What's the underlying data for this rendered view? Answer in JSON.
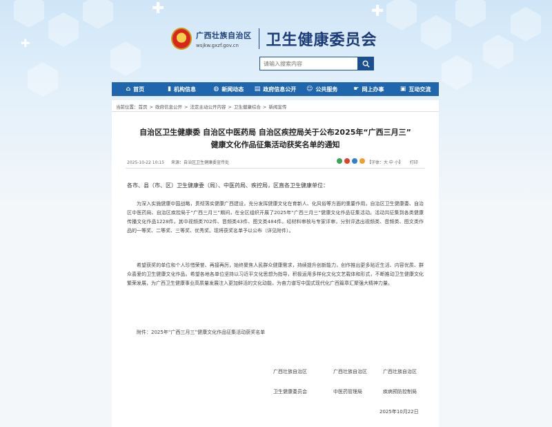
{
  "header": {
    "org_name": "广西壮族自治区",
    "url": "wsjkw.gxzf.gov.cn",
    "site_title": "卫生健康委员会"
  },
  "search": {
    "placeholder": "请输入搜索内容"
  },
  "nav": {
    "items": [
      {
        "label": "首页",
        "icon": "home-icon"
      },
      {
        "label": "机构信息",
        "icon": "bar-chart-icon"
      },
      {
        "label": "新闻动态",
        "icon": "globe-icon"
      },
      {
        "label": "政府信息公开",
        "icon": "document-icon"
      },
      {
        "label": "公共服务",
        "icon": "people-icon"
      },
      {
        "label": "网上办事",
        "icon": "hand-icon"
      },
      {
        "label": "互动交流",
        "icon": "chat-icon"
      }
    ]
  },
  "breadcrumb": {
    "prefix": "当前位置：",
    "items": [
      "首页",
      "政府信息公开",
      "法定主动公开内容",
      "卫生健康综合",
      "新闻宣传"
    ]
  },
  "article": {
    "title_line1": "自治区卫生健康委 自治区中医药局 自治区疾控局关于公布2025年“广西三月三”",
    "title_line2": "健康文化作品征集活动获奖名单的通知",
    "date": "2025-10-22 10:15",
    "source": "来源：自治区卫生健康委宣传处",
    "font_control": "【字体：大 中 小】",
    "print": "打印",
    "salutation": "各市、县（市、区）卫生健康委（局）、中医药局、疾控局，区直各卫生健康单位：",
    "paragraph1": "为深入实施健康中国战略，贯彻落实健康广西建设，充分发挥健康文化在育新人、化风俗等方面的重要作用，自治区卫生健康委、自治区中医药局、自治区疾控局于“广西三月三”期间，在全区组织开展了2025年“广西三月三”健康文化作品征集活动。活动共征集到各类健康传播文化作品1228件，其中视频类702件、音频类43件、图文类484件。经材料审核与专家评审，分别评选出视频类、音频类、图文类作品的一等奖、二等奖、三等奖、优秀奖。现将获奖名单予以公布（详见附件）。",
    "paragraph2": "希望获奖的单位和个人珍惜荣誉、再接再厉，始终聚焦人民群众健康需求，持续提升创新能力，创作推出更多贴近生活、内容优质、群众喜爱的卫生健康文化作品。希望各地各单位坚持以习近平文化思想为指导，积极运用多样化文化文艺载体和形式，不断推动卫生健康文化繁荣发展，为广西卫生健康事业高质量发展注入更加鲜活的文化动能，为奋力谱写中国式现代化广西篇章汇聚强大精神力量。",
    "attachment": "附件：2025年“广西三月三”健康文化作品征集活动获奖名单",
    "signature": {
      "org1_line1": "广西壮族自治区",
      "org1_line2": "卫生健康委员会",
      "org2_line1": "广西壮族自治区",
      "org2_line2": "中医药管理局",
      "org3_line1": "广西壮族自治区",
      "org3_line2": "疾病预防控制局",
      "date": "2025年10月22日"
    }
  },
  "colors": {
    "nav_bg": "#1f66ad",
    "title_blue": "#1b3a78"
  }
}
